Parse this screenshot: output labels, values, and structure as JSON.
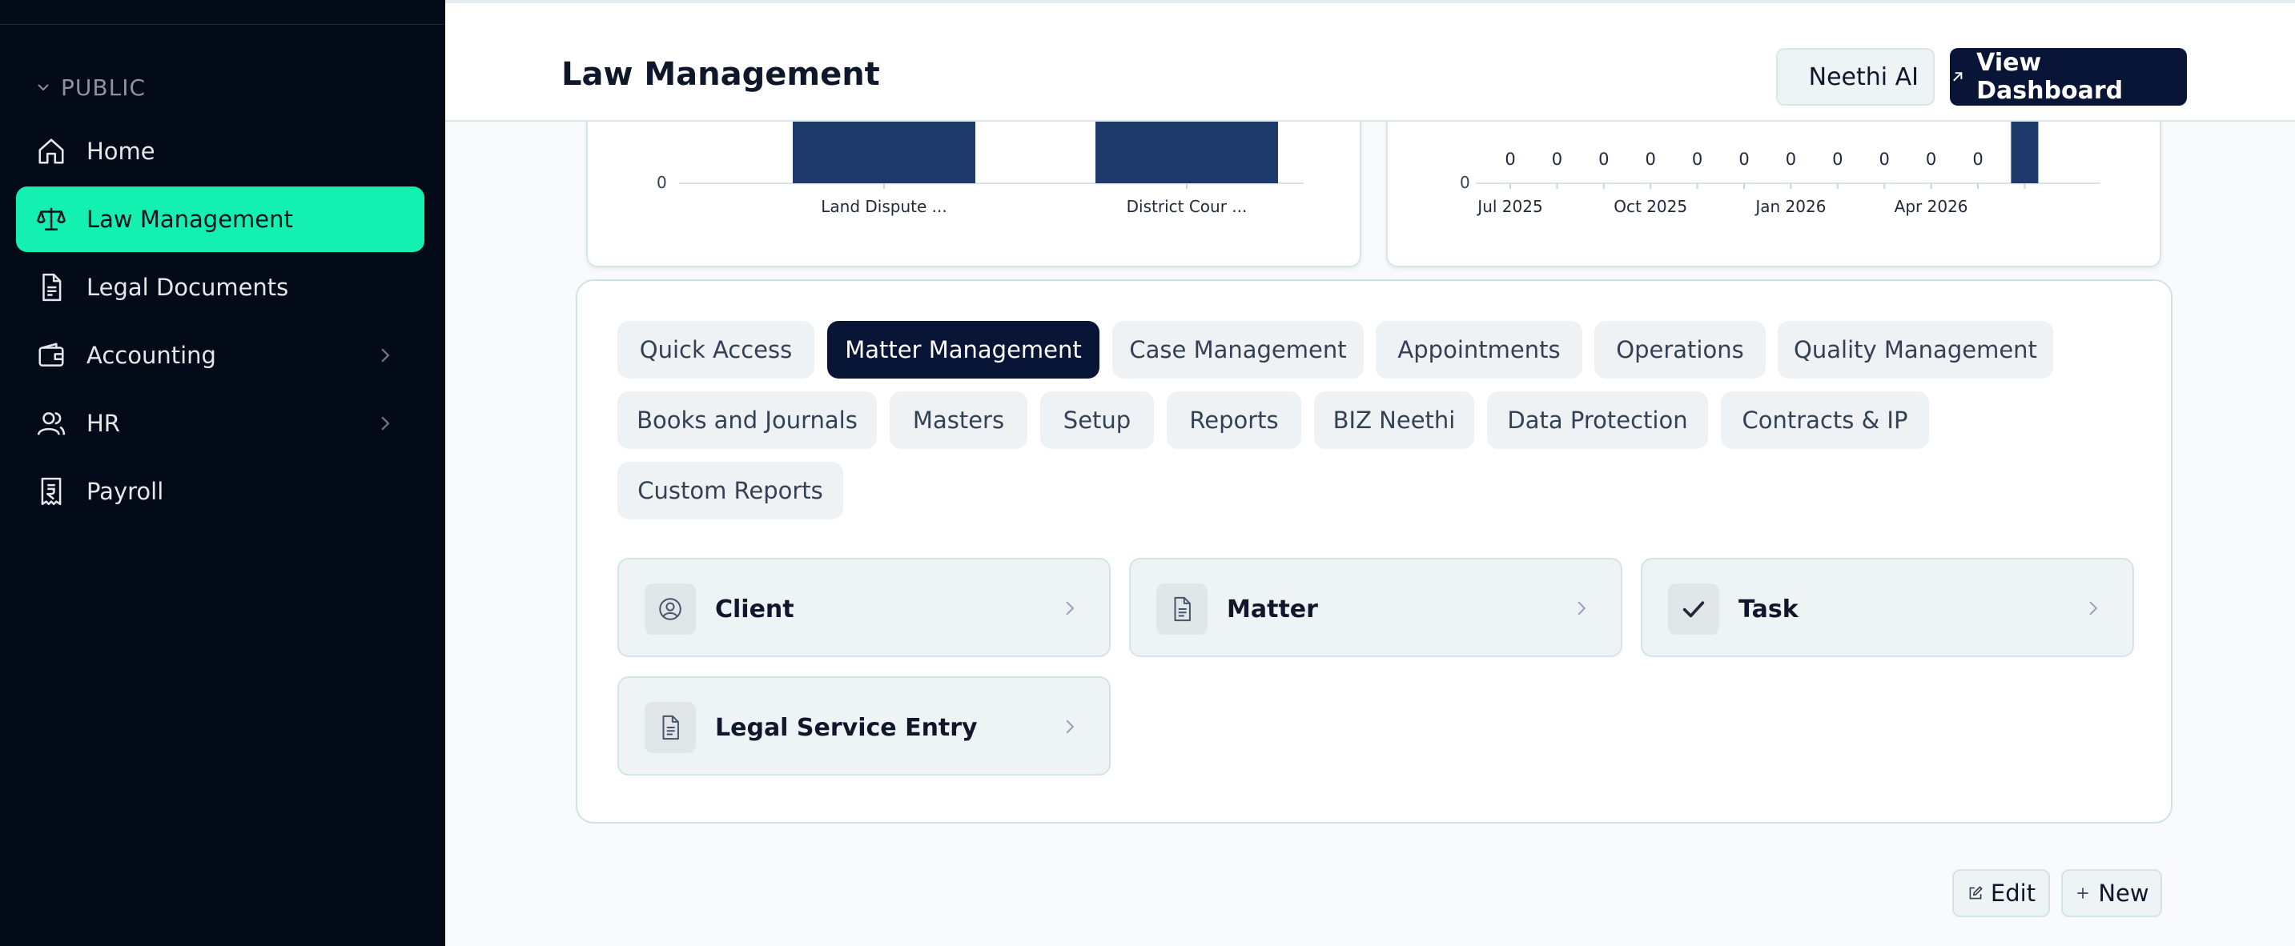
{
  "sidebar": {
    "section": "PUBLIC",
    "items": [
      {
        "label": "Home",
        "icon": "home-icon"
      },
      {
        "label": "Law Management",
        "icon": "scale-icon"
      },
      {
        "label": "Legal Documents",
        "icon": "document-icon"
      },
      {
        "label": "Accounting",
        "icon": "wallet-icon"
      },
      {
        "label": "HR",
        "icon": "users-icon"
      },
      {
        "label": "Payroll",
        "icon": "receipt-icon"
      }
    ]
  },
  "header": {
    "title": "Law Management",
    "ai_label": "Neethi AI",
    "dashboard_label": "View Dashboard"
  },
  "charts": {
    "left_zero": "0",
    "right_zero": "0"
  },
  "chart_data": [
    {
      "type": "bar",
      "categories": [
        "Land Dispute ...",
        "District Cour ..."
      ],
      "values": [
        null,
        null
      ],
      "ylabel": "",
      "xlabel": ""
    },
    {
      "type": "bar",
      "x_tick_labels": [
        "Jul 2025",
        "Oct 2025",
        "Jan 2026",
        "Apr 2026"
      ],
      "data_labels": [
        "0",
        "0",
        "0",
        "0",
        "0",
        "0",
        "0",
        "0",
        "0",
        "0",
        "0"
      ],
      "values": [
        0,
        0,
        0,
        0,
        0,
        0,
        0,
        0,
        0,
        0,
        0,
        null
      ]
    }
  ],
  "tabs": [
    "Quick Access",
    "Matter Management",
    "Case Management",
    "Appointments",
    "Operations",
    "Quality Management",
    "Books and Journals",
    "Masters",
    "Setup",
    "Reports",
    "BIZ Neethi",
    "Data Protection",
    "Contracts & IP",
    "Custom Reports"
  ],
  "active_tab": "Matter Management",
  "tiles": [
    {
      "label": "Client",
      "icon": "user-circle-icon"
    },
    {
      "label": "Matter",
      "icon": "document-icon"
    },
    {
      "label": "Task",
      "icon": "check-icon"
    },
    {
      "label": "Legal Service Entry",
      "icon": "document-icon"
    }
  ],
  "actions": {
    "edit": "Edit",
    "new": "New"
  },
  "colors": {
    "sidebar_bg": "#040b18",
    "active_nav": "#13f0b0",
    "primary": "#081537",
    "bar": "#1d3a6b"
  }
}
